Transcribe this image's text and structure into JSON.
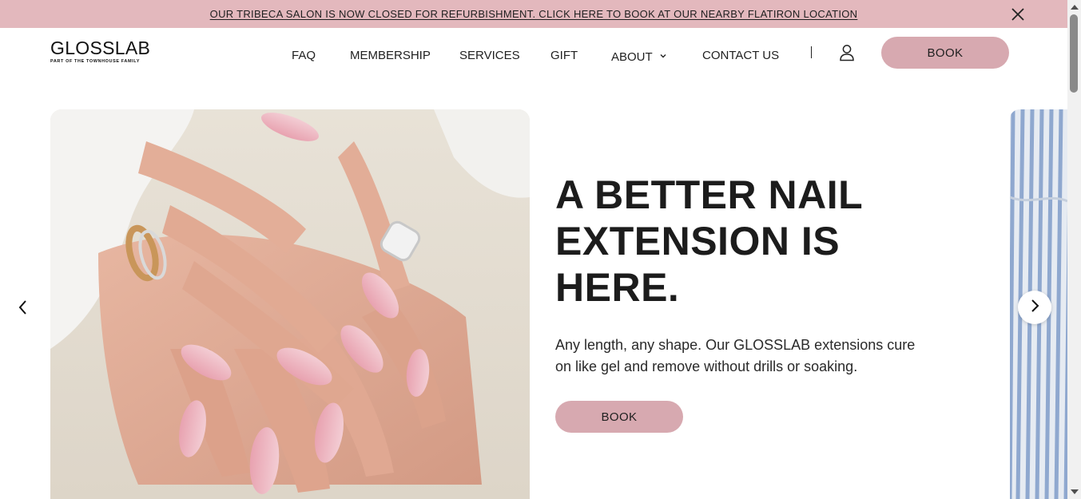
{
  "announcement": {
    "text": "OUR TRIBECA SALON IS NOW CLOSED FOR REFURBISHMENT. CLICK HERE TO BOOK AT OUR NEARBY FLATIRON LOCATION",
    "close_icon": "close-icon"
  },
  "header": {
    "logo": {
      "word": "GLOSSLAB",
      "tagline": "PART OF THE TOWNHOUSE FAMILY"
    },
    "nav": [
      {
        "label": "FAQ"
      },
      {
        "label": "MEMBERSHIP"
      },
      {
        "label": "SERVICES"
      },
      {
        "label": "GIFT"
      },
      {
        "label": "ABOUT",
        "icon": "chevron-down-icon"
      },
      {
        "label": "CONTACT US"
      }
    ],
    "account_icon": "user-icon",
    "book_label": "BOOK"
  },
  "hero": {
    "headline": "A BETTER NAIL EXTENSION IS HERE.",
    "subtext": "Any length, any shape. Our GLOSSLAB extensions cure on like gel and remove without drills or soaking.",
    "book_label": "BOOK",
    "prev_icon": "chevron-left-icon",
    "next_icon": "chevron-right-icon"
  },
  "colors": {
    "announcement_bg": "#e3b8bd",
    "button_bg": "#d7a9b0",
    "text": "#1f1f1f"
  }
}
